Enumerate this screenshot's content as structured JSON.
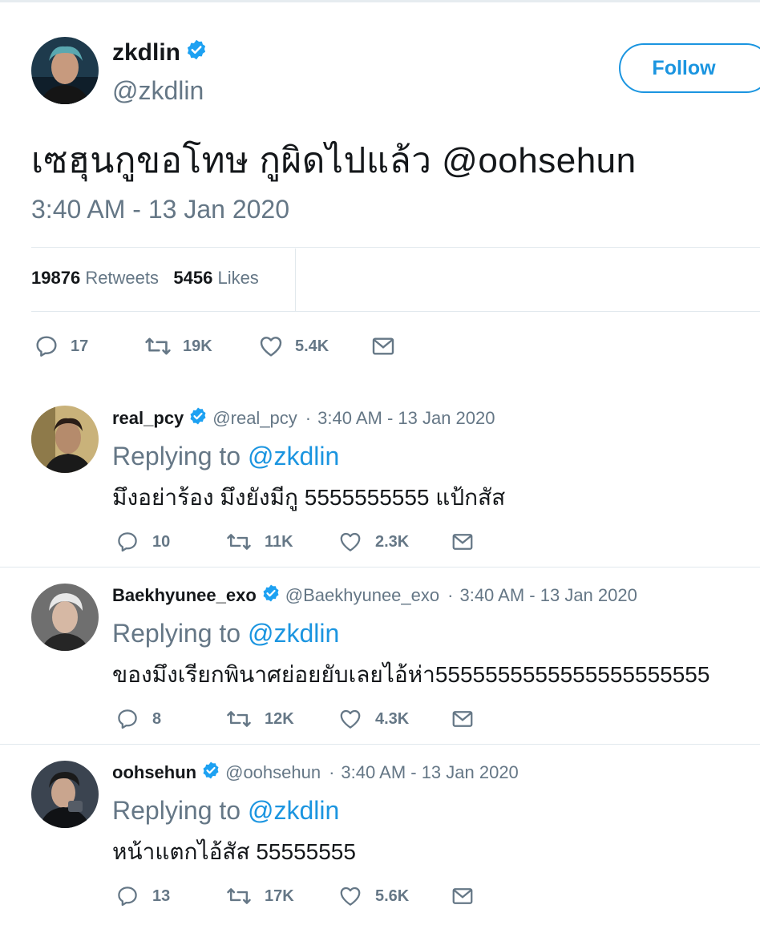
{
  "main": {
    "name": "zkdlin",
    "handle": "@zkdlin",
    "follow_label": "Follow",
    "text": "เซฮุนกูขอโทษ กูผิดไปแล้ว ",
    "mention": "@oohsehun",
    "timestamp": "3:40 AM - 13 Jan 2020",
    "retweets_count": "19876",
    "retweets_label": "Retweets",
    "likes_count": "5456",
    "likes_label": "Likes",
    "actions": {
      "replies": "17",
      "retweets": "19K",
      "likes": "5.4K"
    }
  },
  "replies": [
    {
      "name": "real_pcy",
      "handle": "@real_pcy",
      "dot": "·",
      "timestamp": "3:40 AM - 13 Jan 2020",
      "replying_prefix": "Replying to ",
      "replying_to": "@zkdlin",
      "text": "มึงอย่าร้อง มึงยังมีกู 5555555555 แป้กสัส",
      "actions": {
        "replies": "10",
        "retweets": "11K",
        "likes": "2.3K"
      }
    },
    {
      "name": "Baekhyunee_exo",
      "handle": "@Baekhyunee_exo",
      "dot": "·",
      "timestamp": "3:40 AM - 13 Jan 2020",
      "replying_prefix": "Replying to ",
      "replying_to": "@zkdlin",
      "text": "ของมึงเรียกพินาศย่อยยับเลยไอ้ห่า5555555555555555555555",
      "actions": {
        "replies": "8",
        "retweets": "12K",
        "likes": "4.3K"
      }
    },
    {
      "name": "oohsehun",
      "handle": "@oohsehun",
      "dot": "·",
      "timestamp": "3:40 AM - 13 Jan 2020",
      "replying_prefix": "Replying to ",
      "replying_to": "@zkdlin",
      "text": "หน้าแตกไอ้สัส 55555555",
      "actions": {
        "replies": "13",
        "retweets": "17K",
        "likes": "5.6K"
      }
    }
  ],
  "icons": {
    "reply": "reply-icon",
    "retweet": "retweet-icon",
    "like": "heart-icon",
    "dm": "envelope-icon",
    "verified": "verified-badge-icon"
  },
  "colors": {
    "accent": "#1b95e0",
    "muted": "#657786",
    "text": "#14171a",
    "divider": "#e1e8ed"
  }
}
